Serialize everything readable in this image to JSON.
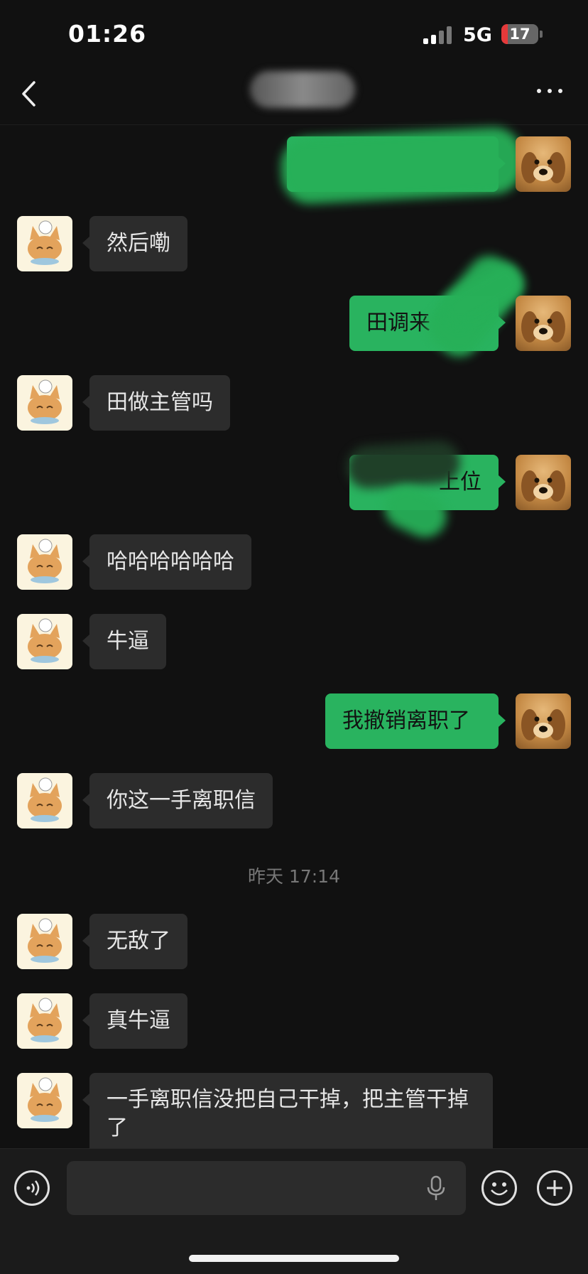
{
  "status_bar": {
    "time": "01:26",
    "network": "5G",
    "battery": "17",
    "battery_level": 0.17
  },
  "nav": {
    "back_icon": "chevron-left-icon",
    "more_icon": "ellipsis-icon"
  },
  "messages": [
    {
      "side": "left",
      "text": "然后嘞"
    },
    {
      "side": "right",
      "text": "田调来"
    },
    {
      "side": "left",
      "text": "田做主管吗"
    },
    {
      "side": "right",
      "text": "上位"
    },
    {
      "side": "left",
      "text": "哈哈哈哈哈哈"
    },
    {
      "side": "left",
      "text": "牛逼"
    },
    {
      "side": "right",
      "text": "我撤销离职了"
    },
    {
      "side": "left",
      "text": "你这一手离职信"
    },
    {
      "side": "left",
      "text": "无敌了"
    },
    {
      "side": "left",
      "text": "真牛逼"
    },
    {
      "side": "left",
      "text": "一手离职信没把自己干掉，把主管干掉了"
    }
  ],
  "timestamp": "昨天 17:14",
  "input_bar": {
    "voice_icon": "voice-icon",
    "mic_icon": "microphone-icon",
    "emoji_icon": "emoji-icon",
    "add_icon": "plus-icon"
  },
  "colors": {
    "background": "#111111",
    "incoming_bubble": "#2c2c2c",
    "outgoing_bubble": "#29b35f"
  }
}
